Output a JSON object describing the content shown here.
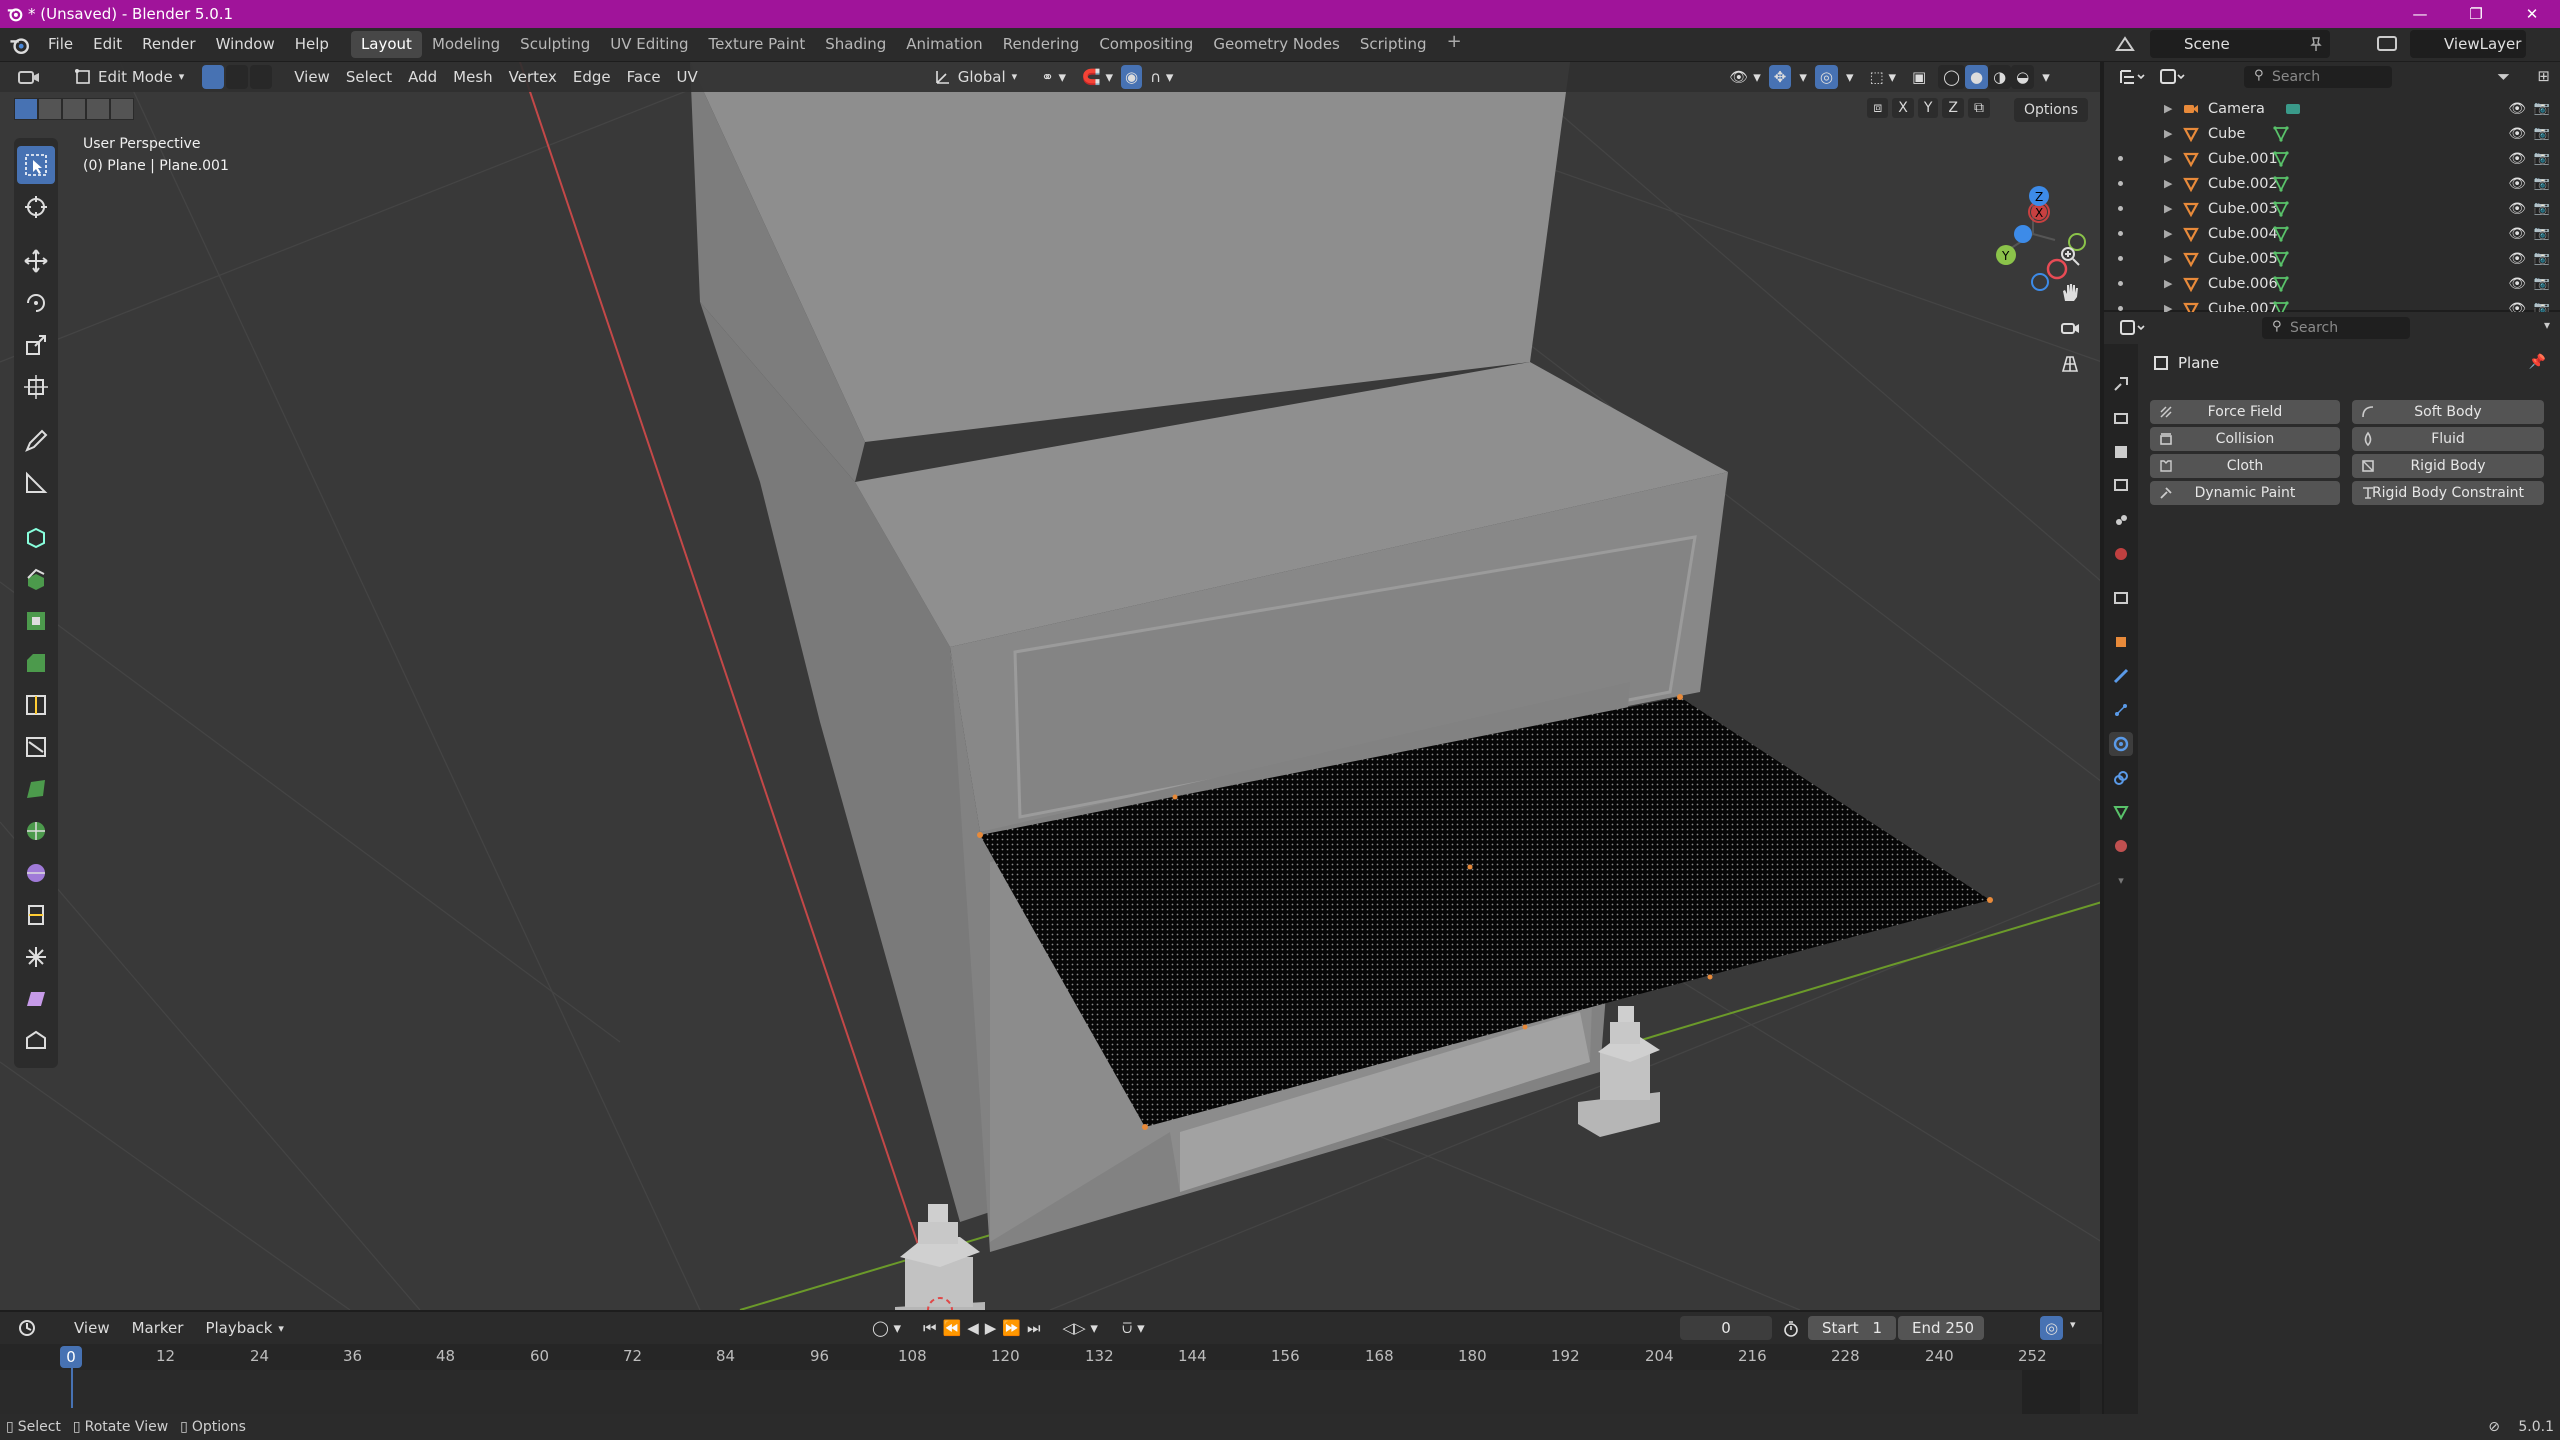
{
  "window": {
    "title": "* (Unsaved) - Blender 5.0.1",
    "minimize": "—",
    "restore": "❐",
    "close": "✕"
  },
  "menu": [
    "File",
    "Edit",
    "Render",
    "Window",
    "Help"
  ],
  "workspaces": [
    "Layout",
    "Modeling",
    "Sculpting",
    "UV Editing",
    "Texture Paint",
    "Shading",
    "Animation",
    "Rendering",
    "Compositing",
    "Geometry Nodes",
    "Scripting"
  ],
  "active_workspace": "Layout",
  "scene": "Scene",
  "view_layer": "ViewLayer",
  "viewport": {
    "mode": "Edit Mode",
    "header_menus": [
      "View",
      "Select",
      "Add",
      "Mesh",
      "Vertex",
      "Edge",
      "Face",
      "UV"
    ],
    "transform_orientation": "Global",
    "options_label": "Options",
    "axis_labels": [
      "X",
      "Y",
      "Z"
    ],
    "perspective": "User Perspective",
    "object_info": "(0) Plane | Plane.001",
    "gizmo": {
      "x": "X",
      "y": "Y",
      "z": "Z"
    }
  },
  "timeline": {
    "menus": [
      "View",
      "Marker",
      "Playback"
    ],
    "current_frame": "0",
    "start_label": "Start",
    "start": "1",
    "end_label": "End",
    "end": "250",
    "ruler": [
      "0",
      "12",
      "24",
      "36",
      "48",
      "60",
      "72",
      "84",
      "96",
      "108",
      "120",
      "132",
      "144",
      "156",
      "168",
      "180",
      "192",
      "204",
      "216",
      "228",
      "240",
      "252"
    ]
  },
  "status": {
    "select": "Select",
    "rotate": "Rotate View",
    "options": "Options",
    "version": "5.0.1"
  },
  "outliner": {
    "search_placeholder": "Search",
    "items": [
      "Camera",
      "Cube",
      "Cube.001",
      "Cube.002",
      "Cube.003",
      "Cube.004",
      "Cube.005",
      "Cube.006",
      "Cube.007"
    ]
  },
  "properties": {
    "search_placeholder": "Search",
    "object_name": "Plane",
    "physics_buttons": [
      [
        "Force Field",
        "Soft Body"
      ],
      [
        "Collision",
        "Fluid"
      ],
      [
        "Cloth",
        "Rigid Body"
      ],
      [
        "Dynamic Paint",
        "Rigid Body Constraint"
      ]
    ]
  },
  "colors": {
    "title_bar": "#a0149a",
    "accent": "#4772b3",
    "x_axis": "#e84b55",
    "y_axis": "#8bc34a",
    "z_axis": "#3d8be8",
    "object_orange": "#e88a3a",
    "mesh_green": "#59c26a"
  }
}
